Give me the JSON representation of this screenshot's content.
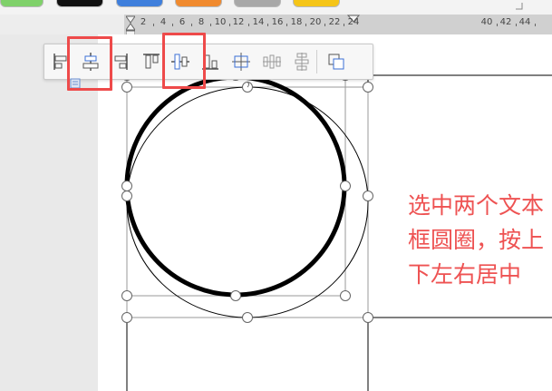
{
  "ruler": {
    "numbers": [
      "2",
      "4",
      "6",
      "8",
      "10",
      "12",
      "14",
      "16",
      "18",
      "20",
      "22",
      "24",
      "40",
      "42",
      "44"
    ]
  },
  "toolbar": {
    "buttons": [
      {
        "name": "align-left-icon",
        "highlighted": false
      },
      {
        "name": "align-center-icon",
        "highlighted": true
      },
      {
        "name": "align-right-icon",
        "highlighted": false
      },
      {
        "name": "align-top-icon",
        "highlighted": false
      },
      {
        "name": "align-middle-icon",
        "highlighted": true
      },
      {
        "name": "align-bottom-icon",
        "highlighted": false
      },
      {
        "name": "align-page-center-icon",
        "highlighted": false
      },
      {
        "name": "distribute-horizontal-icon",
        "highlighted": false
      },
      {
        "name": "distribute-vertical-icon",
        "highlighted": false
      },
      {
        "name": "combine-shapes-icon",
        "highlighted": false
      }
    ]
  },
  "annotation": {
    "text": "选中两个文本框圆圈，按上下左右居中"
  },
  "colors": {
    "highlight": "#ee4a4a",
    "annotation": "#ee5252",
    "icon": "#555555",
    "icon_accent": "#3b6fd6"
  }
}
